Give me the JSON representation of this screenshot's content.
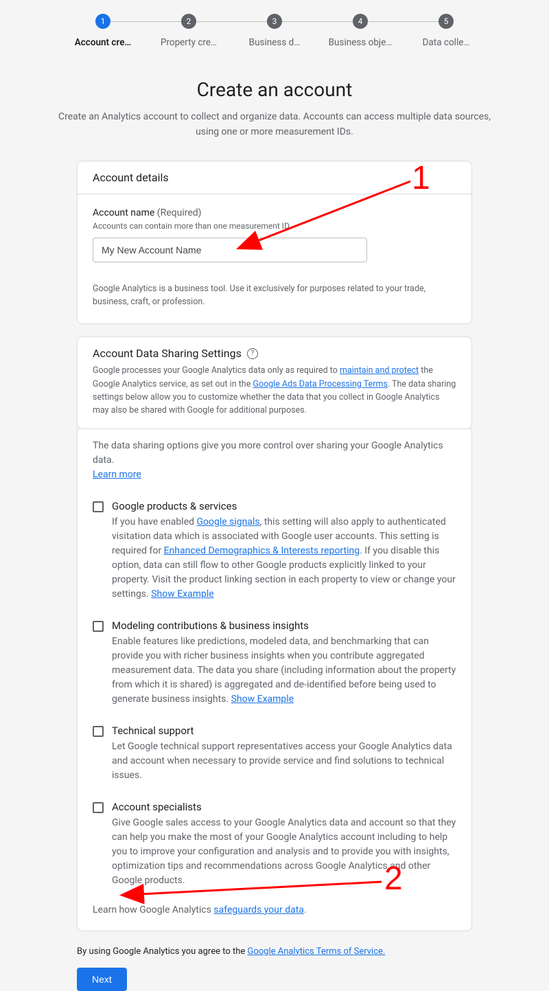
{
  "stepper": {
    "steps": [
      {
        "num": "1",
        "label": "Account cre…",
        "active": true
      },
      {
        "num": "2",
        "label": "Property cre…",
        "active": false
      },
      {
        "num": "3",
        "label": "Business d…",
        "active": false
      },
      {
        "num": "4",
        "label": "Business obje…",
        "active": false
      },
      {
        "num": "5",
        "label": "Data colle…",
        "active": false
      }
    ]
  },
  "heading": "Create an account",
  "subheading": "Create an Analytics account to collect and organize data. Accounts can access multiple data sources, using one or more measurement IDs.",
  "account_details": {
    "title": "Account details",
    "label_main": "Account name",
    "label_req": " (Required)",
    "hint": "Accounts can contain more than one measurement ID.",
    "input_value": "My New Account Name",
    "note": "Google Analytics is a business tool. Use it exclusively for purposes related to your trade, business, craft, or profession."
  },
  "sharing": {
    "title": "Account Data Sharing Settings",
    "desc_pre": "Google processes your Google Analytics data only as required to ",
    "desc_link1": "maintain and protect",
    "desc_mid1": " the Google Analytics service, as set out in the ",
    "desc_link2": "Google Ads Data Processing Terms",
    "desc_post": ". The data sharing settings below allow you to customize whether the data that you collect in Google Analytics may also be shared with Google for additional purposes."
  },
  "options_intro": "The data sharing options give you more control over sharing your Google Analytics data.",
  "learn_more": "Learn more",
  "options": [
    {
      "title": "Google products & services",
      "desc_pre": "If you have enabled ",
      "link1": "Google signals",
      "desc_mid1": ", this setting will also apply to authenticated visitation data which is associated with Google user accounts. This setting is required for ",
      "link2": "Enhanced Demographics & Interests reporting",
      "desc_mid2": ". If you disable this option, data can still flow to other Google products explicitly linked to your property. Visit the product linking section in each property to view or change your settings. ",
      "show_example": "Show Example"
    },
    {
      "title": "Modeling contributions & business insights",
      "desc": "Enable features like predictions, modeled data, and benchmarking that can provide you with richer business insights when you contribute aggregated measurement data. The data you share (including information about the property from which it is shared) is aggregated and de-identified before being used to generate business insights. ",
      "show_example": "Show Example"
    },
    {
      "title": "Technical support",
      "desc": "Let Google technical support representatives access your Google Analytics data and account when necessary to provide service and find solutions to technical issues."
    },
    {
      "title": "Account specialists",
      "desc": "Give Google sales access to your Google Analytics data and account so that they can help you make the most of your Google Analytics account including to help you to improve your configuration and analysis and to provide you with insights, optimization tips and recommendations across Google Analytics and other Google products."
    }
  ],
  "safeguards_pre": "Learn how Google Analytics ",
  "safeguards_link": "safeguards your data",
  "safeguards_post": ".",
  "terms_pre": "By using Google Analytics you agree to the ",
  "terms_link": "Google Analytics Terms of Service.",
  "next": "Next",
  "annotations": {
    "one": "1",
    "two": "2"
  }
}
